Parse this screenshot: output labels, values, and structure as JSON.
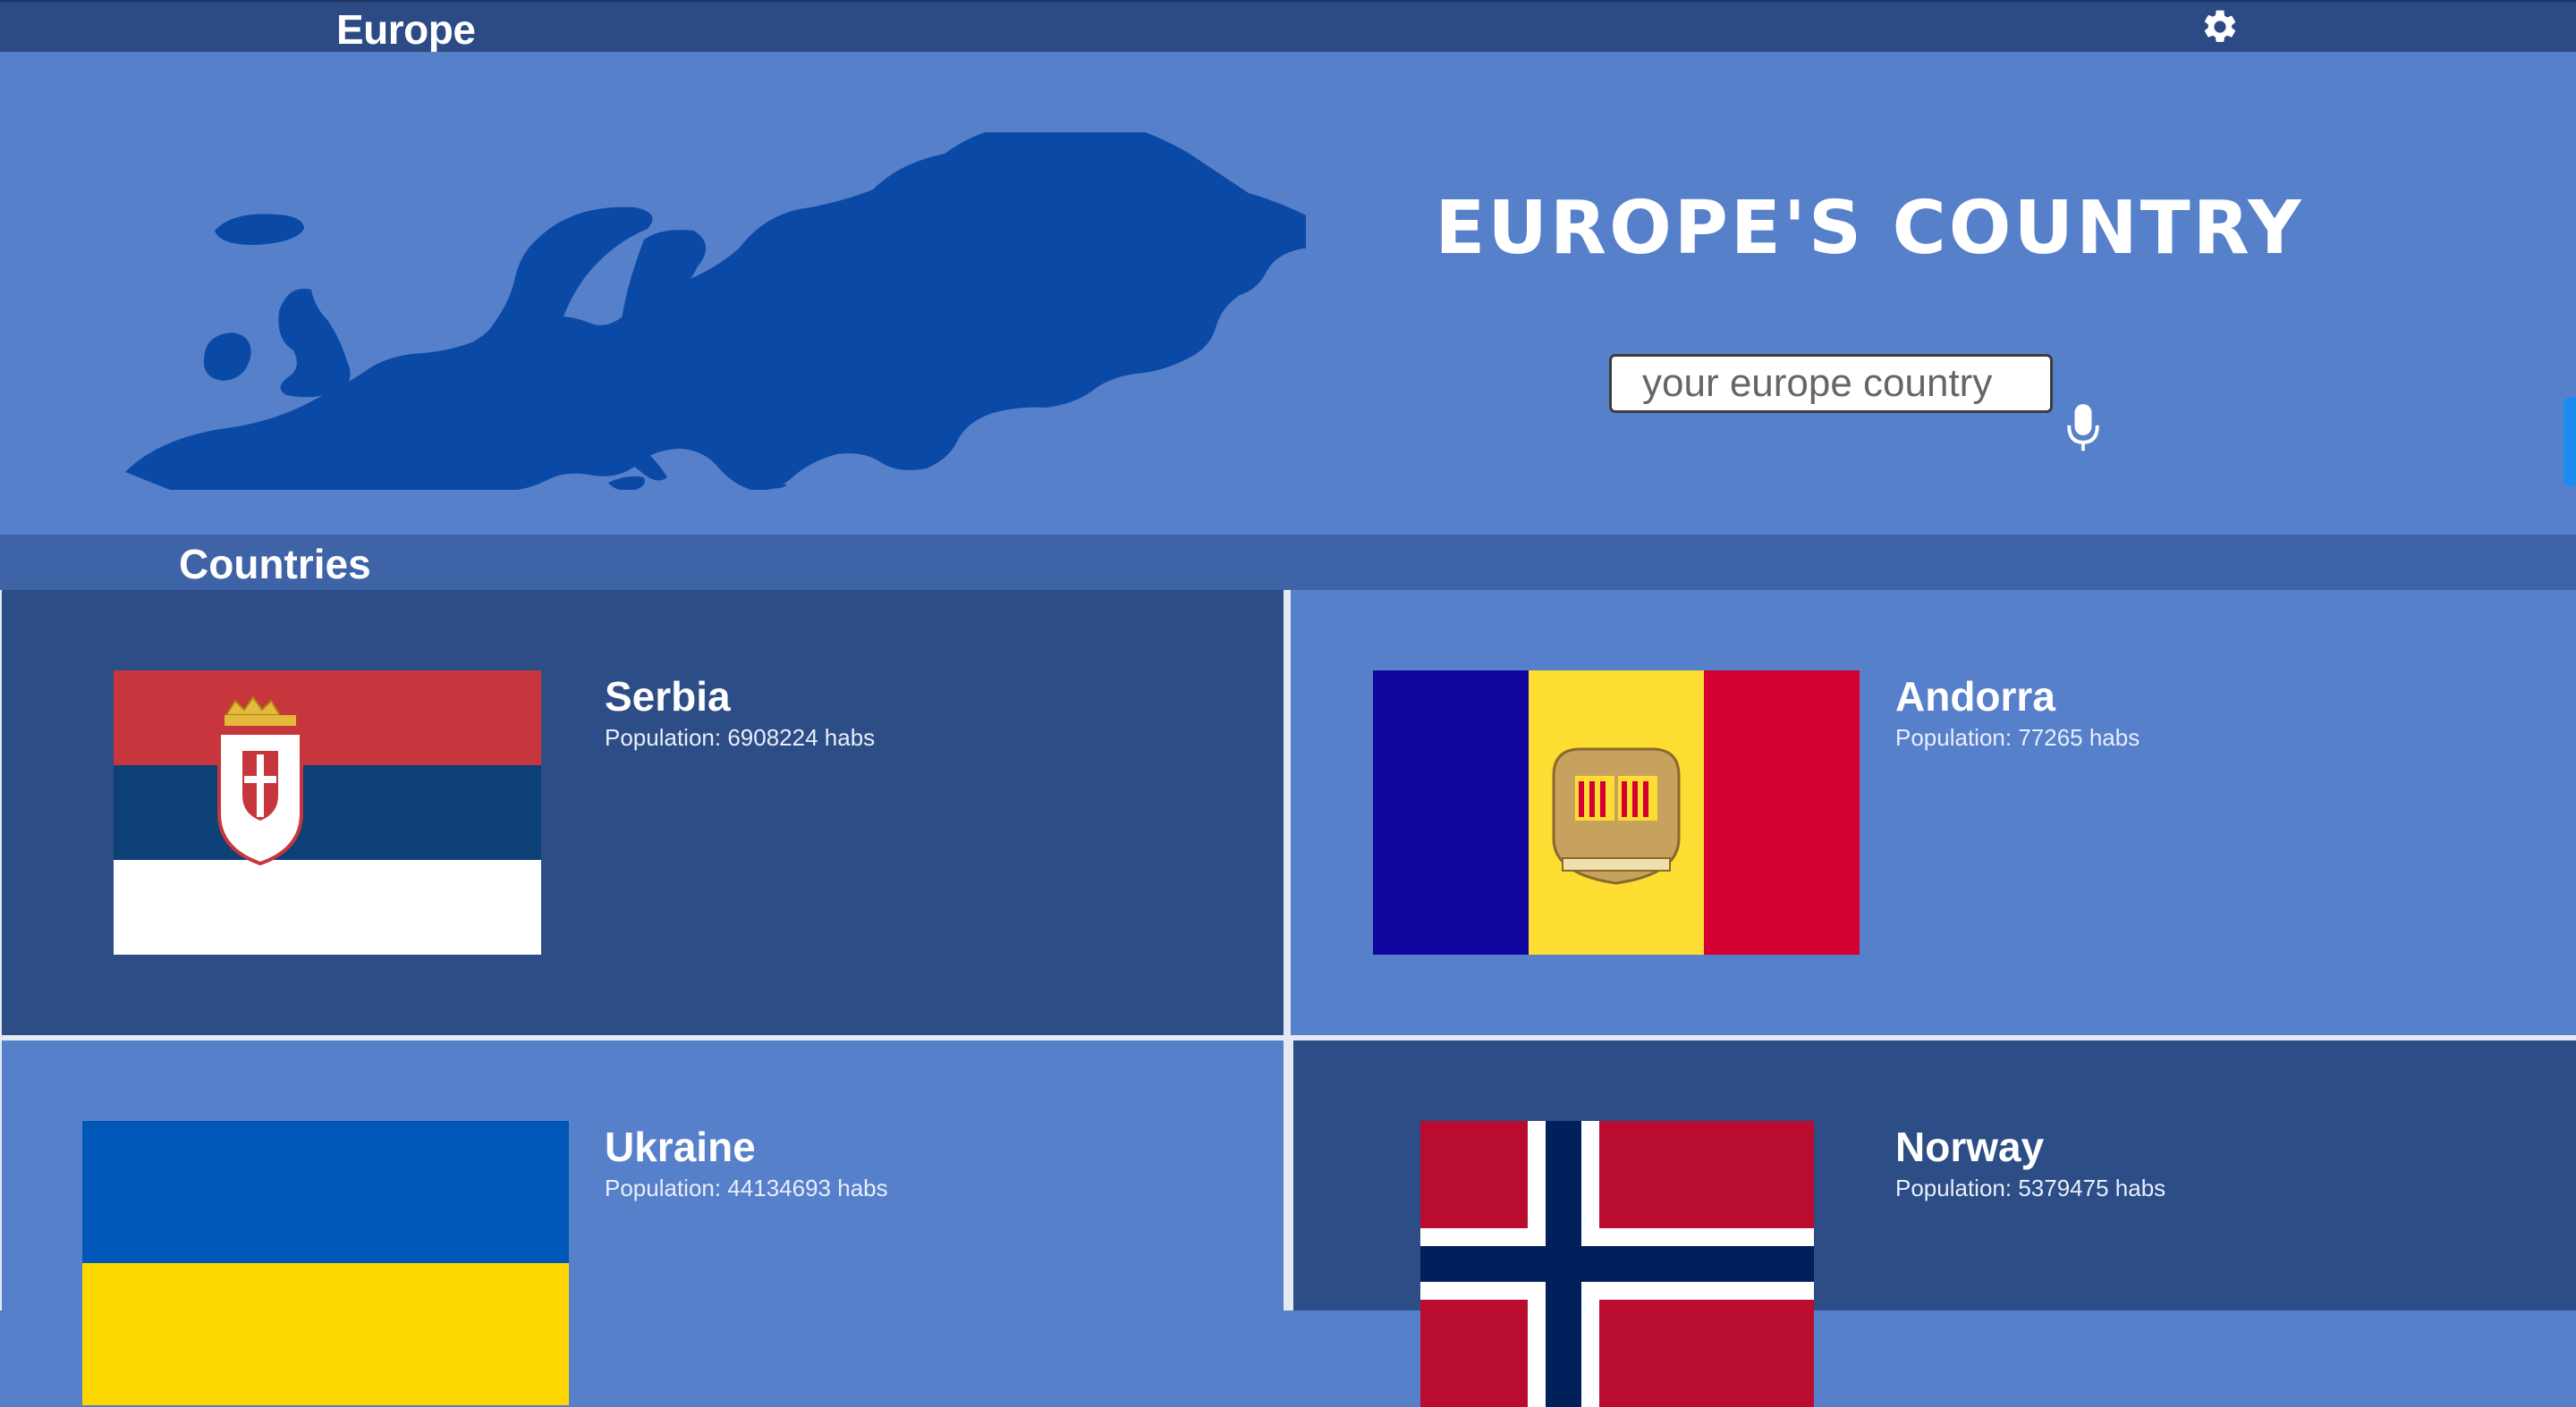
{
  "header": {
    "title": "Europe",
    "settings_icon": "gear-icon"
  },
  "hero": {
    "headline": "EUROPE'S COUNTRY",
    "search": {
      "placeholder": "your europe country",
      "value": ""
    },
    "mic_icon": "microphone-icon"
  },
  "section": {
    "title": "Countries"
  },
  "countries": [
    {
      "name": "Serbia",
      "population": "Population: 6908224 habs"
    },
    {
      "name": "Andorra",
      "population": "Population: 77265 habs"
    },
    {
      "name": "Ukraine",
      "population": "Population: 44134693 habs"
    },
    {
      "name": "Norway",
      "population": "Population: 5379475 habs"
    }
  ],
  "colors": {
    "topbar": "#2c4a84",
    "hero": "#5780cb",
    "section_bar": "#3f63a7",
    "card_dark": "#2c4d85",
    "card_light": "#5780cb",
    "map": "#0a4aa6"
  }
}
